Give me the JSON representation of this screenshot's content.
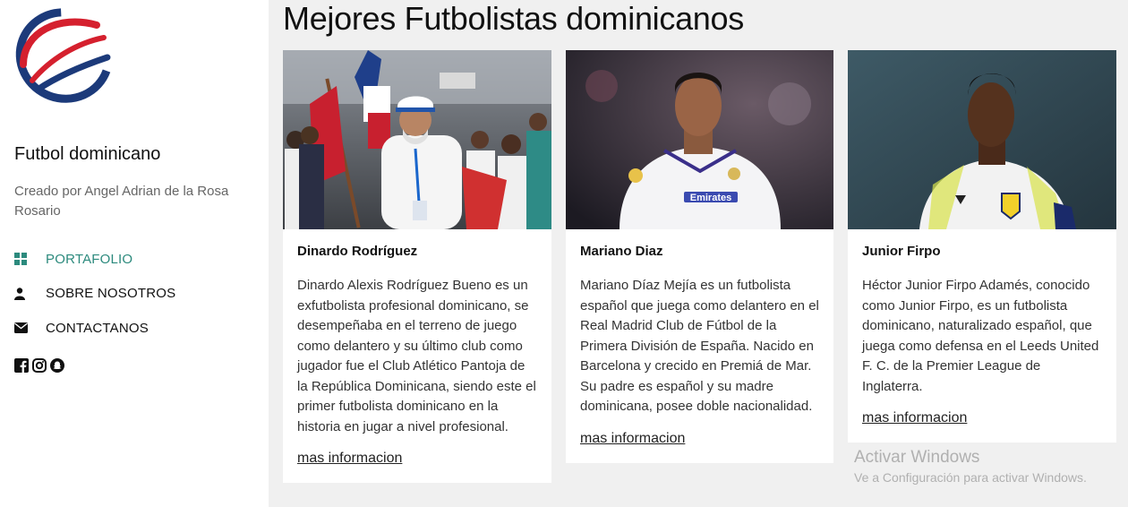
{
  "sidebar": {
    "site_title": "Futbol dominicano",
    "credit": "Creado por Angel Adrian de la Rosa Rosario",
    "nav": [
      {
        "label": "PORTAFOLIO",
        "icon": "grid-icon"
      },
      {
        "label": "SOBRE NOSOTROS",
        "icon": "user-icon"
      },
      {
        "label": "CONTACTANOS",
        "icon": "envelope-icon"
      }
    ],
    "social": [
      "facebook-icon",
      "instagram-icon",
      "snapchat-icon"
    ]
  },
  "main": {
    "title": "Mejores Futbolistas dominicanos",
    "cards": [
      {
        "name": "Dinardo Rodríguez",
        "description": "Dinardo Alexis Rodríguez Bueno es un exfutbolista profesional dominicano, se desempeñaba en el terreno de juego como delantero y su último club como jugador fue el Club Atlético Pantoja de la República Dominicana, siendo este el primer futbolista dominicano en la historia en jugar a nivel profesional.",
        "link": "mas informacion"
      },
      {
        "name": "Mariano Diaz",
        "description": "Mariano Díaz Mejía es un futbolista español que juega como delantero en el Real Madrid Club de Fútbol de la Primera División de España. Nacido en Barcelona y crecido en Premiá de Mar. Su padre es español y su madre dominicana, posee doble nacionalidad.",
        "link": "mas informacion"
      },
      {
        "name": "Junior Firpo",
        "description": "Héctor Junior Firpo Adamés, conocido como Junior Firpo, es un futbolista dominicano, naturalizado español, que juega como defensa en el Leeds United F. C. de la Premier League de Inglaterra.",
        "link": "mas informacion"
      }
    ]
  },
  "os_watermark": {
    "title": "Activar Windows",
    "subtitle": "Ve a Configuración para activar Windows."
  },
  "colors": {
    "accent": "#2c8a7d",
    "logo_red": "#d5202e",
    "logo_blue": "#1c3a7a"
  }
}
